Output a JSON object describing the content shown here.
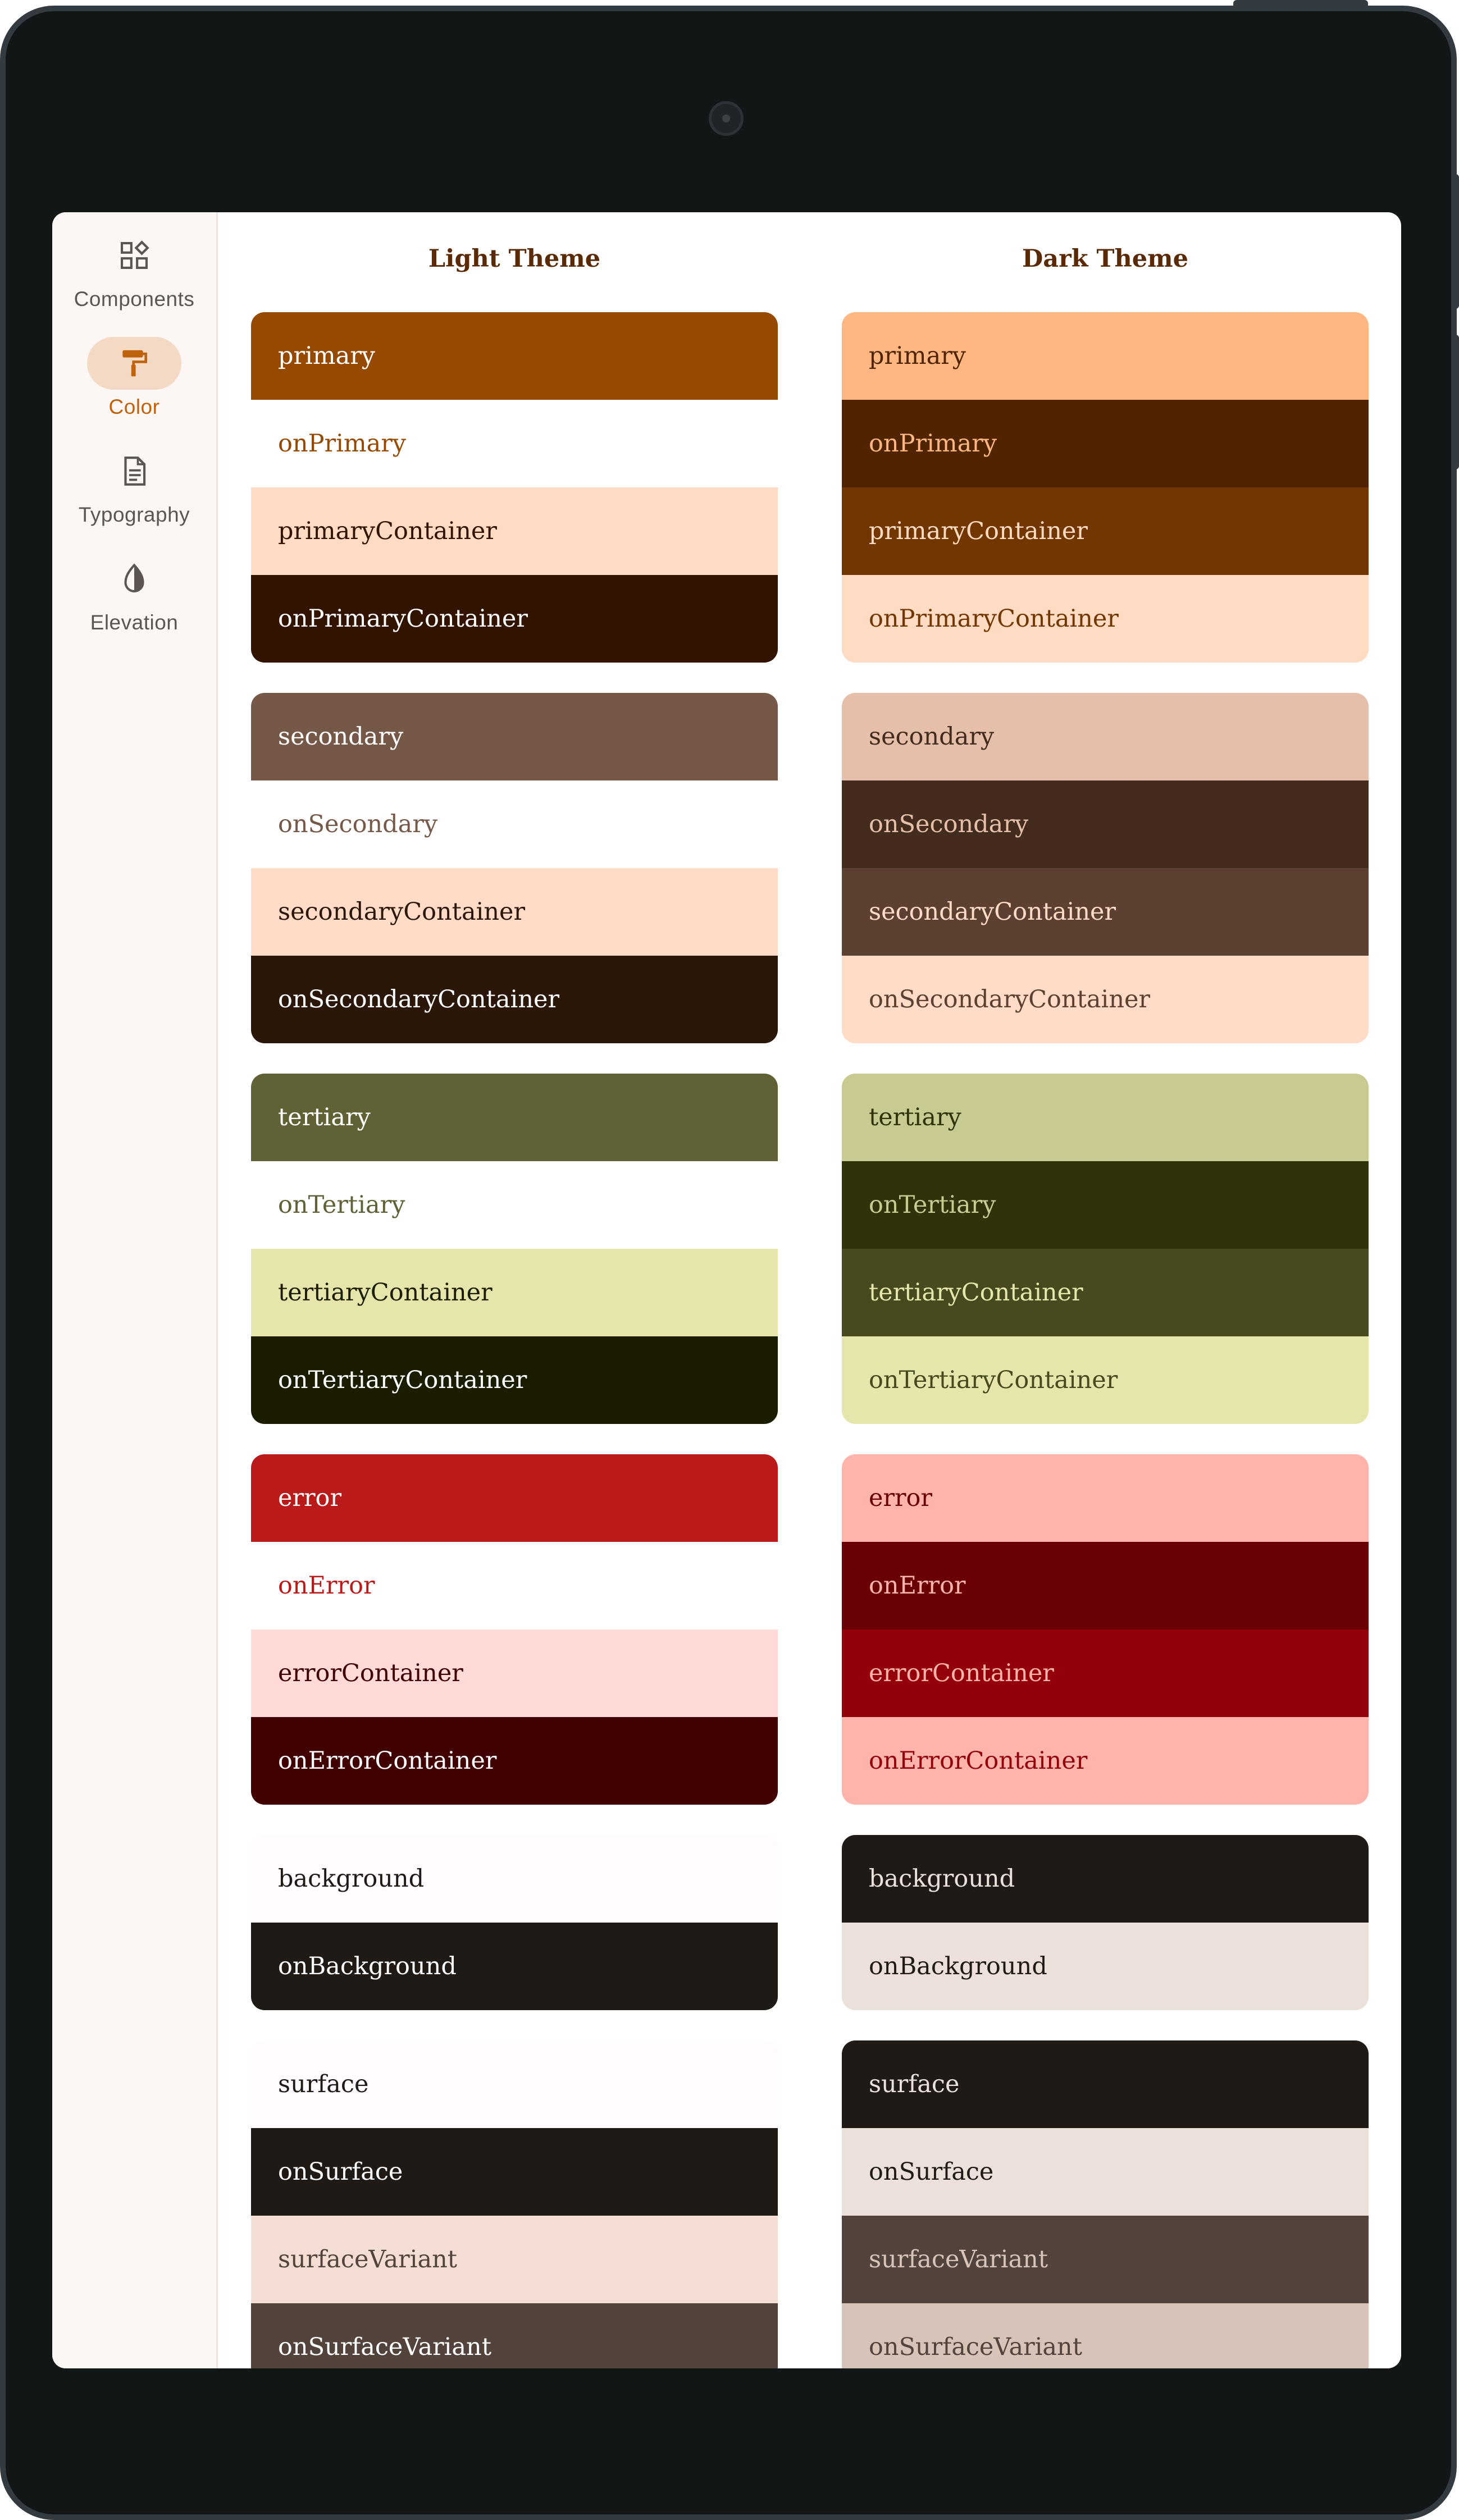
{
  "nav": [
    {
      "label": "Components",
      "icon": "widgets-icon",
      "active": false
    },
    {
      "label": "Color",
      "icon": "paint-roller-icon",
      "active": true
    },
    {
      "label": "Typography",
      "icon": "article-icon",
      "active": false
    },
    {
      "label": "Elevation",
      "icon": "contrast-icon",
      "active": false
    }
  ],
  "light_title": "Light Theme",
  "dark_title": "Dark Theme",
  "light": [
    [
      {
        "label": "primary",
        "bg": "#964900",
        "fg": "#ffffff"
      },
      {
        "label": "onPrimary",
        "bg": "#ffffff",
        "fg": "#964900"
      },
      {
        "label": "primaryContainer",
        "bg": "#ffdbc3",
        "fg": "#311300"
      },
      {
        "label": "onPrimaryContainer",
        "bg": "#311300",
        "fg": "#ffffff"
      }
    ],
    [
      {
        "label": "secondary",
        "bg": "#765848",
        "fg": "#ffffff"
      },
      {
        "label": "onSecondary",
        "bg": "#ffffff",
        "fg": "#765848"
      },
      {
        "label": "secondaryContainer",
        "bg": "#ffdbc8",
        "fg": "#2b160a"
      },
      {
        "label": "onSecondaryContainer",
        "bg": "#2b160a",
        "fg": "#ffffff"
      }
    ],
    [
      {
        "label": "tertiary",
        "bg": "#606134",
        "fg": "#ffffff"
      },
      {
        "label": "onTertiary",
        "bg": "#ffffff",
        "fg": "#606134"
      },
      {
        "label": "tertiaryContainer",
        "bg": "#e5e5ac",
        "fg": "#1c1d00"
      },
      {
        "label": "onTertiaryContainer",
        "bg": "#1c1d00",
        "fg": "#ffffff"
      }
    ],
    [
      {
        "label": "error",
        "bg": "#ba1a1a",
        "fg": "#ffffff"
      },
      {
        "label": "onError",
        "bg": "#ffffff",
        "fg": "#ba1a1a"
      },
      {
        "label": "errorContainer",
        "bg": "#ffdad6",
        "fg": "#410002"
      },
      {
        "label": "onErrorContainer",
        "bg": "#410002",
        "fg": "#ffffff"
      }
    ],
    [
      {
        "label": "background",
        "bg": "#fffbff",
        "fg": "#201a17"
      },
      {
        "label": "onBackground",
        "bg": "#201a17",
        "fg": "#ffffff"
      }
    ],
    [
      {
        "label": "surface",
        "bg": "#fffbff",
        "fg": "#201a17"
      },
      {
        "label": "onSurface",
        "bg": "#201a17",
        "fg": "#ffffff"
      },
      {
        "label": "surfaceVariant",
        "bg": "#f4ded3",
        "fg": "#52443c"
      },
      {
        "label": "onSurfaceVariant",
        "bg": "#52443c",
        "fg": "#ffffff"
      }
    ]
  ],
  "dark": [
    [
      {
        "label": "primary",
        "bg": "#ffb781",
        "fg": "#502400"
      },
      {
        "label": "onPrimary",
        "bg": "#502400",
        "fg": "#ffb781"
      },
      {
        "label": "primaryContainer",
        "bg": "#723600",
        "fg": "#ffdbc3"
      },
      {
        "label": "onPrimaryContainer",
        "bg": "#ffdbc3",
        "fg": "#723600"
      }
    ],
    [
      {
        "label": "secondary",
        "bg": "#e5bfa9",
        "fg": "#432b1d"
      },
      {
        "label": "onSecondary",
        "bg": "#432b1d",
        "fg": "#e5bfa9"
      },
      {
        "label": "secondaryContainer",
        "bg": "#5c4132",
        "fg": "#ffdbc8"
      },
      {
        "label": "onSecondaryContainer",
        "bg": "#ffdbc8",
        "fg": "#5c4132"
      }
    ],
    [
      {
        "label": "tertiary",
        "bg": "#c9c992",
        "fg": "#31320a"
      },
      {
        "label": "onTertiary",
        "bg": "#31320a",
        "fg": "#c9c992"
      },
      {
        "label": "tertiaryContainer",
        "bg": "#48491f",
        "fg": "#e5e5ac"
      },
      {
        "label": "onTertiaryContainer",
        "bg": "#e5e5ac",
        "fg": "#48491f"
      }
    ],
    [
      {
        "label": "error",
        "bg": "#ffb4ab",
        "fg": "#690005"
      },
      {
        "label": "onError",
        "bg": "#690005",
        "fg": "#ffb4ab"
      },
      {
        "label": "errorContainer",
        "bg": "#93000a",
        "fg": "#ffb4ab"
      },
      {
        "label": "onErrorContainer",
        "bg": "#ffb4ab",
        "fg": "#93000a"
      }
    ],
    [
      {
        "label": "background",
        "bg": "#201a17",
        "fg": "#ece0da"
      },
      {
        "label": "onBackground",
        "bg": "#ece0da",
        "fg": "#201a17"
      }
    ],
    [
      {
        "label": "surface",
        "bg": "#201a17",
        "fg": "#ece0da"
      },
      {
        "label": "onSurface",
        "bg": "#ece0da",
        "fg": "#201a17"
      },
      {
        "label": "surfaceVariant",
        "bg": "#52443c",
        "fg": "#d7c3b8"
      },
      {
        "label": "onSurfaceVariant",
        "bg": "#d7c3b8",
        "fg": "#52443c"
      }
    ]
  ]
}
